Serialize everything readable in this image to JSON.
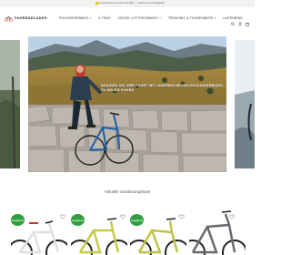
{
  "topbar": {
    "promo": "Kostenlose Versand ab 50€ — Lieferung & Rückgabe"
  },
  "header": {
    "logo_text": "FAHRRADLADEN",
    "nav": [
      {
        "label": "ROCKRIDERBIKES",
        "dropdown": true
      },
      {
        "label": "E-TRAD",
        "dropdown": false
      },
      {
        "label": "CROSS- & FITNESSBIKES",
        "dropdown": true
      },
      {
        "label": "TREKKING- & TOURENBIKES",
        "dropdown": true
      },
      {
        "label": "LASTENRAD",
        "dropdown": false
      }
    ],
    "icons": [
      "search-icon",
      "account-icon",
      "cart-icon"
    ]
  },
  "hero": {
    "caption": "BRINGEN SIE IHRE FAHRT MIT UNSEREN NEUEN ROCKRIDERBIKES ZU NEUEN HÖHEN"
  },
  "section": {
    "title": "Aktuelle Sonderangebote"
  },
  "products": [
    {
      "badge": "Angebot!",
      "frame_color": "#e0e0e0",
      "accent": "#c0392b"
    },
    {
      "badge": "Angebot!",
      "frame_color": "#c5c94a",
      "accent": "#2e9e3f"
    },
    {
      "badge": "Angebot!",
      "frame_color": "#bfc24a",
      "accent": "#2e9e3f"
    },
    {
      "badge": "Angebot!",
      "frame_color": "#666b70",
      "accent": "#222"
    }
  ],
  "colors": {
    "badge_green": "#2e9e3f",
    "topbar_bg": "#f2f2f2"
  }
}
